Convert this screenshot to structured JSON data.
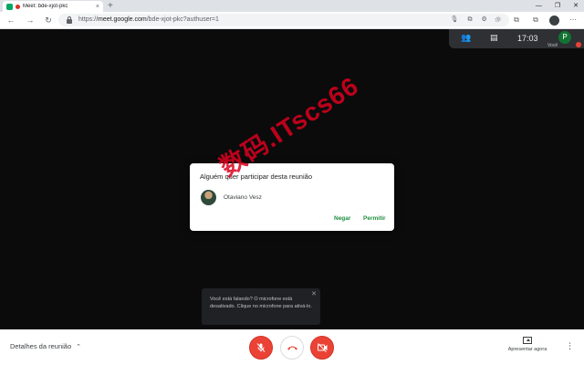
{
  "browser": {
    "tab_title": "Meet: bde-xjot-pkc",
    "tab_close": "×",
    "new_tab": "+",
    "window_controls": [
      "—",
      "❐",
      "✕"
    ],
    "nav": {
      "back": "←",
      "forward": "→",
      "reload": "↻"
    },
    "url_prefix": "https://",
    "url_host": "meet.google.com",
    "url_path": "/bde-xjot-pkc?authuser=1",
    "omnibox_icons": [
      "🎙",
      "⧉",
      "⚙",
      "☆"
    ],
    "toolbar_icons": [
      "☆",
      "⧉",
      "⧉"
    ]
  },
  "meet_top": {
    "people_icon": "👥",
    "chat_icon": "▤",
    "time": "17:03",
    "self_initial": "P",
    "self_label": "Você"
  },
  "dialog": {
    "title": "Alguém quer participar desta reunião",
    "requester_name": "Otaviano Vesz",
    "deny_label": "Negar",
    "allow_label": "Permitir"
  },
  "watermark": "数码.ITscs66",
  "toast": {
    "message": "Você está falando? O microfone está desativado. Clique no microfone para ativá-lo.",
    "close": "✕"
  },
  "bottom_bar": {
    "details_label": "Detalhes da reunião",
    "details_chevron": "⌃",
    "present_label": "Apresentar agora",
    "more": "⋮"
  }
}
